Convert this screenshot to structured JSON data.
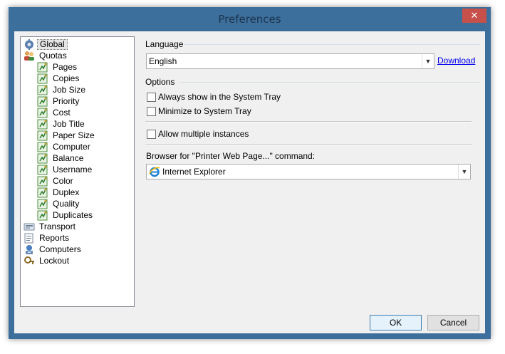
{
  "window": {
    "title": "Preferences",
    "close_glyph": "✕"
  },
  "tree": {
    "items": [
      {
        "label": "Global",
        "icon": "gear-icon",
        "level": 0,
        "selected": true
      },
      {
        "label": "Quotas",
        "icon": "users-icon",
        "level": 0
      },
      {
        "label": "Pages",
        "icon": "quota-icon",
        "level": 1
      },
      {
        "label": "Copies",
        "icon": "quota-icon",
        "level": 1
      },
      {
        "label": "Job Size",
        "icon": "quota-icon",
        "level": 1
      },
      {
        "label": "Priority",
        "icon": "quota-icon",
        "level": 1
      },
      {
        "label": "Cost",
        "icon": "quota-icon",
        "level": 1
      },
      {
        "label": "Job Title",
        "icon": "quota-icon",
        "level": 1
      },
      {
        "label": "Paper Size",
        "icon": "quota-icon",
        "level": 1
      },
      {
        "label": "Computer",
        "icon": "quota-icon",
        "level": 1
      },
      {
        "label": "Balance",
        "icon": "quota-icon",
        "level": 1
      },
      {
        "label": "Username",
        "icon": "quota-icon",
        "level": 1
      },
      {
        "label": "Color",
        "icon": "quota-icon",
        "level": 1
      },
      {
        "label": "Duplex",
        "icon": "quota-icon",
        "level": 1
      },
      {
        "label": "Quality",
        "icon": "quota-icon",
        "level": 1
      },
      {
        "label": "Duplicates",
        "icon": "quota-icon",
        "level": 1
      },
      {
        "label": "Transport",
        "icon": "transport-icon",
        "level": 0
      },
      {
        "label": "Reports",
        "icon": "reports-icon",
        "level": 0
      },
      {
        "label": "Computers",
        "icon": "computers-icon",
        "level": 0
      },
      {
        "label": "Lockout",
        "icon": "lockout-icon",
        "level": 0
      }
    ]
  },
  "language": {
    "section_label": "Language",
    "selected": "English",
    "download_link": "Download"
  },
  "options": {
    "section_label": "Options",
    "always_tray": {
      "label": "Always show in the System Tray",
      "checked": false
    },
    "minimize_tray": {
      "label": "Minimize to System Tray",
      "checked": false
    },
    "multiple_instances": {
      "label": "Allow multiple instances",
      "checked": false
    },
    "browser_label": "Browser for \"Printer Web Page...\" command:",
    "browser_selected": "Internet Explorer",
    "browser_icon": "ie-icon"
  },
  "buttons": {
    "ok": "OK",
    "cancel": "Cancel"
  },
  "colors": {
    "titlebar": "#3c6f9b",
    "close": "#c7504a",
    "link": "#0000ee"
  }
}
